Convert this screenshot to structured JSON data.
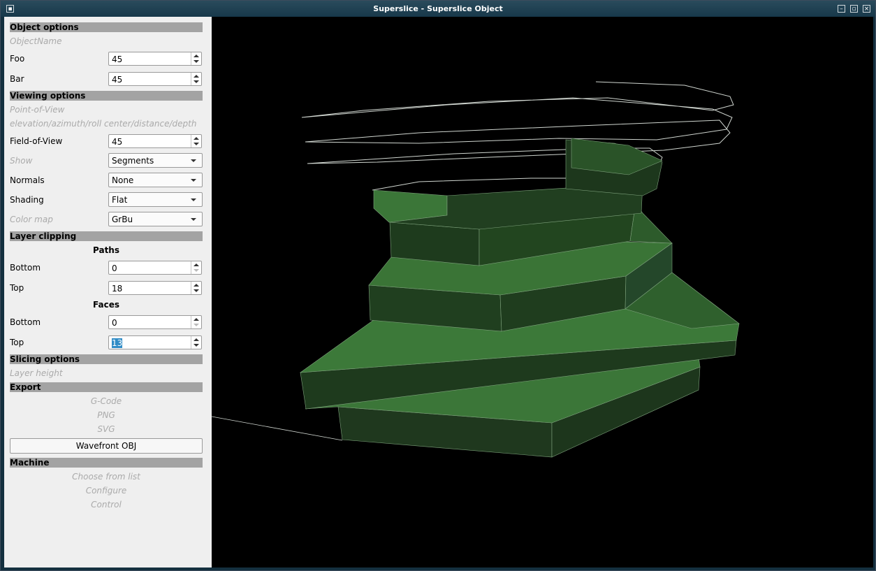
{
  "window": {
    "title": "Superslice - Superslice Object",
    "menu_icon": "window-menu-icon",
    "minimize_icon": "minimize-icon",
    "maximize_icon": "maximize-icon",
    "close_icon": "close-icon"
  },
  "panel": {
    "object_options": {
      "header": "Object options",
      "object_name_placeholder": "ObjectName",
      "foo_label": "Foo",
      "foo_value": "45",
      "bar_label": "Bar",
      "bar_value": "45"
    },
    "viewing_options": {
      "header": "Viewing options",
      "pov_label": "Point-of-View",
      "pov_hint": "elevation/azimuth/roll center/distance/depth",
      "fov_label": "Field-of-View",
      "fov_value": "45",
      "show_label": "Show",
      "show_value": "Segments",
      "normals_label": "Normals",
      "normals_value": "None",
      "shading_label": "Shading",
      "shading_value": "Flat",
      "colormap_label": "Color map",
      "colormap_value": "GrBu"
    },
    "layer_clipping": {
      "header": "Layer clipping",
      "paths_label": "Paths",
      "paths_bottom_label": "Bottom",
      "paths_bottom_value": "0",
      "paths_top_label": "Top",
      "paths_top_value": "18",
      "faces_label": "Faces",
      "faces_bottom_label": "Bottom",
      "faces_bottom_value": "0",
      "faces_top_label": "Top",
      "faces_top_value": "13"
    },
    "slicing_options": {
      "header": "Slicing options",
      "layer_height_label": "Layer height"
    },
    "export": {
      "header": "Export",
      "gcode": "G-Code",
      "png": "PNG",
      "svg": "SVG",
      "wavefront": "Wavefront OBJ"
    },
    "machine": {
      "header": "Machine",
      "choose": "Choose from list",
      "configure": "Configure",
      "control": "Control"
    }
  },
  "colors": {
    "face_light": "#3d7a3a",
    "face_dark": "#1e3a1d",
    "edge": "#bfc9bf",
    "background": "#000000"
  }
}
